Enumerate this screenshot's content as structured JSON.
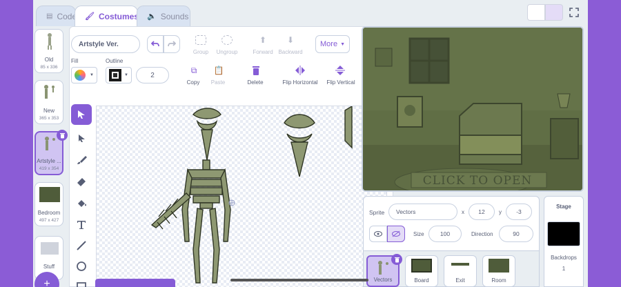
{
  "tabs": {
    "code": "Code",
    "costumes": "Costumes",
    "sounds": "Sounds"
  },
  "costumes": [
    {
      "name": "Old",
      "size": "85 x 336"
    },
    {
      "name": "New",
      "size": "365 x 353"
    },
    {
      "name": "Artstyle ...",
      "size": "419 x 354"
    },
    {
      "name": "Bedroom",
      "size": "497 x 427"
    },
    {
      "name": "Stuff",
      "size": ""
    }
  ],
  "editor": {
    "costume_name": "Artstyle Ver.",
    "fill_label": "Fill",
    "outline_label": "Outline",
    "outline_width": "2",
    "group": "Group",
    "ungroup": "Ungroup",
    "forward": "Forward",
    "backward": "Backward",
    "more": "More",
    "copy": "Copy",
    "paste": "Paste",
    "delete": "Delete",
    "flip_h": "Flip Horizontal",
    "flip_v": "Flip Vertical"
  },
  "stage": {
    "overlay_text": "CLICK TO OPEN"
  },
  "sprite": {
    "label": "Sprite",
    "name": "Vectors",
    "x_label": "x",
    "x": "12",
    "y_label": "y",
    "y": "-3",
    "size_label": "Size",
    "size": "100",
    "direction_label": "Direction",
    "direction": "90"
  },
  "sprites": [
    "Vectors",
    "Board",
    "Exit",
    "Room"
  ],
  "stage_panel": {
    "title": "Stage",
    "backdrops_label": "Backdrops",
    "backdrops_count": "1"
  },
  "colors": {
    "accent": "#855cd6",
    "green_flag": "#4cbf56",
    "stop": "#ec5959",
    "stage_tint": "#4f5c3a"
  }
}
